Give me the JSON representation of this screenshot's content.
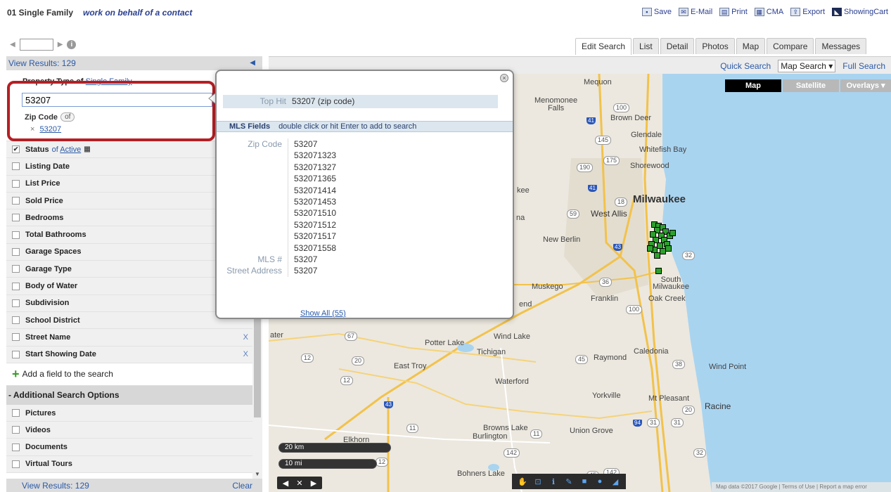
{
  "header": {
    "title": "01 Single Family",
    "subtitle": "work on behalf of a contact",
    "actions": [
      {
        "label": "Save",
        "icon": "save-icon"
      },
      {
        "label": "E-Mail",
        "icon": "email-icon"
      },
      {
        "label": "Print",
        "icon": "print-icon"
      },
      {
        "label": "CMA",
        "icon": "cma-icon"
      },
      {
        "label": "Export",
        "icon": "export-icon"
      },
      {
        "label": "ShowingCart",
        "icon": "showingcart-icon"
      }
    ]
  },
  "pager": {
    "value": ""
  },
  "tabs": [
    {
      "label": "Edit Search",
      "active": true
    },
    {
      "label": "List"
    },
    {
      "label": "Detail"
    },
    {
      "label": "Photos"
    },
    {
      "label": "Map"
    },
    {
      "label": "Compare"
    },
    {
      "label": "Messages"
    }
  ],
  "search_modes": {
    "quick": "Quick Search",
    "map": "Map Search",
    "full": "Full Search"
  },
  "left_panel": {
    "view_results": "View Results: 129",
    "property_type_label": "Property Type of",
    "property_type_value": "Single Family",
    "zip_input_value": "53207",
    "zip_code_label": "Zip Code",
    "zip_code_of": "of",
    "zip_chip_value": "53207",
    "status_label": "Status",
    "status_of": "of",
    "status_value": "Active",
    "fields": [
      "Listing Date",
      "List Price",
      "Sold Price",
      "Bedrooms",
      "Total Bathrooms",
      "Garage Spaces",
      "Garage Type",
      "Body of Water",
      "Subdivision",
      "School District"
    ],
    "removable_fields": [
      "Street Name",
      "Start Showing Date"
    ],
    "remove_label": "X",
    "add_field": "Add a field to the search",
    "additional_header": "- Additional Search Options",
    "additional_fields": [
      "Pictures",
      "Videos",
      "Documents",
      "Virtual Tours"
    ],
    "footer_results": "View Results: 129",
    "clear": "Clear"
  },
  "popup": {
    "top_hit_label": "Top Hit",
    "top_hit_value": "53207  (zip code)",
    "mls_fields_label": "MLS Fields",
    "mls_fields_hint": "double click or hit Enter to add to search",
    "groups": [
      {
        "label": "Zip Code",
        "values": [
          "53207",
          "532071323",
          "532071327",
          "532071365",
          "532071414",
          "532071453",
          "532071510",
          "532071512",
          "532071517",
          "532071558"
        ]
      },
      {
        "label": "MLS #",
        "values": [
          "53207"
        ]
      },
      {
        "label": "Street Address",
        "values": [
          "53207"
        ]
      }
    ],
    "show_all": "Show All (55)"
  },
  "map": {
    "buttons": {
      "map": "Map",
      "satellite": "Satellite",
      "overlays": "Overlays ▾"
    },
    "places": {
      "mequon": "Mequon",
      "menomonee_falls": "Menomonee\nFalls",
      "brown_deer": "Brown Deer",
      "glendale": "Glendale",
      "whitefish_bay": "Whitefish Bay",
      "shorewood": "Shorewood",
      "milwaukee": "Milwaukee",
      "west_allis": "West Allis",
      "new_berlin": "New Berlin",
      "south_milwaukee": "South\nMilwaukee",
      "oak_creek": "Oak Creek",
      "franklin": "Franklin",
      "muskego": "Muskego",
      "wind_lake": "Wind Lake",
      "potter_lake": "Potter Lake",
      "tichigan": "Tichigan",
      "raymond": "Raymond",
      "caledonia": "Caledonia",
      "wind_point": "Wind Point",
      "east_troy": "East Troy",
      "waterford": "Waterford",
      "yorkville": "Yorkville",
      "mt_pleasant": "Mt Pleasant",
      "racine": "Racine",
      "browns_lake": "Browns Lake",
      "burlington": "Burlington",
      "union_grove": "Union Grove",
      "elkhorn": "Elkhorn",
      "bohners_lake": "Bohners Lake",
      "kee": "kee",
      "na": "na",
      "end": "end",
      "ater": "ater"
    },
    "shields": [
      "100",
      "145",
      "175",
      "190",
      "18",
      "59",
      "36",
      "100",
      "67",
      "32",
      "20",
      "45",
      "38",
      "12",
      "12",
      "11",
      "31",
      "20",
      "142",
      "12",
      "142",
      "45",
      "11",
      "32",
      "31",
      "20"
    ],
    "interstates": [
      "41",
      "41",
      "43",
      "43",
      "94"
    ],
    "scale_km": "20 km",
    "scale_mi": "10 mi",
    "attribution": "Map data ©2017 Google  |  Terms of Use  |  Report a map error"
  }
}
